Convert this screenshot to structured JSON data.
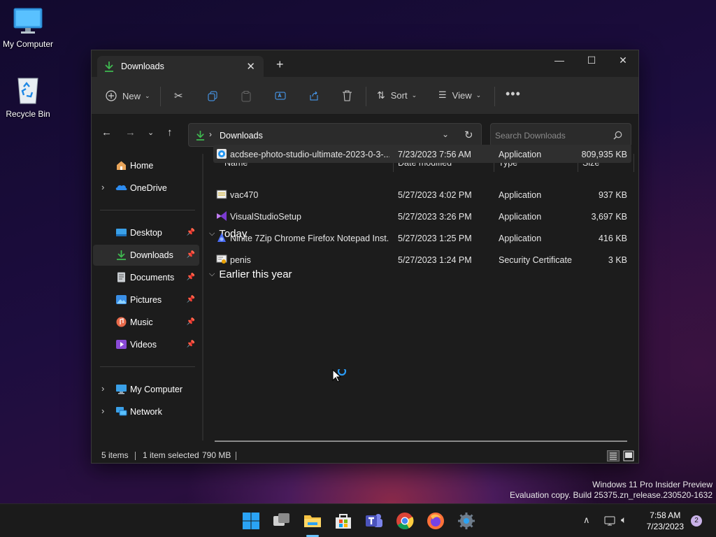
{
  "desktop": {
    "icons": [
      {
        "label": "My Computer"
      },
      {
        "label": "Recycle Bin"
      }
    ]
  },
  "window": {
    "tab_title": "Downloads",
    "toolbar": {
      "new_label": "New",
      "sort_label": "Sort",
      "view_label": "View"
    },
    "address": {
      "location": "Downloads"
    },
    "search": {
      "placeholder": "Search Downloads"
    },
    "sidebar": {
      "items": [
        {
          "label": "Home",
          "icon": "home-icon"
        },
        {
          "label": "OneDrive",
          "icon": "onedrive-icon"
        },
        {
          "label": "Desktop",
          "icon": "desktop-folder-icon"
        },
        {
          "label": "Downloads",
          "icon": "downloads-folder-icon"
        },
        {
          "label": "Documents",
          "icon": "documents-folder-icon"
        },
        {
          "label": "Pictures",
          "icon": "pictures-folder-icon"
        },
        {
          "label": "Music",
          "icon": "music-folder-icon"
        },
        {
          "label": "Videos",
          "icon": "videos-folder-icon"
        },
        {
          "label": "My Computer",
          "icon": "computer-icon"
        },
        {
          "label": "Network",
          "icon": "network-icon"
        }
      ]
    },
    "columns": {
      "name": "Name",
      "date": "Date modified",
      "type": "Type",
      "size": "Size"
    },
    "groups": [
      {
        "label": "Today",
        "files": [
          {
            "name": "acdsee-photo-studio-ultimate-2023-0-3-...",
            "date": "7/23/2023 7:56 AM",
            "type": "Application",
            "size": "809,935 KB"
          }
        ]
      },
      {
        "label": "Earlier this year",
        "files": [
          {
            "name": "vac470",
            "date": "5/27/2023 4:02 PM",
            "type": "Application",
            "size": "937 KB"
          },
          {
            "name": "VisualStudioSetup",
            "date": "5/27/2023 3:26 PM",
            "type": "Application",
            "size": "3,697 KB"
          },
          {
            "name": "Ninite 7Zip Chrome Firefox Notepad Inst...",
            "date": "5/27/2023 1:25 PM",
            "type": "Application",
            "size": "416 KB"
          },
          {
            "name": "penis",
            "date": "5/27/2023 1:24 PM",
            "type": "Security Certificate",
            "size": "3 KB"
          }
        ]
      }
    ],
    "status": {
      "items": "5 items",
      "selected": "1 item selected",
      "selected_size": "790 MB"
    }
  },
  "watermark": {
    "line1": "Windows 11 Pro Insider Preview",
    "line2": "Evaluation copy. Build 25375.zn_release.230520-1632"
  },
  "taskbar": {
    "time": "7:58 AM",
    "date": "7/23/2023",
    "notification_count": "2"
  },
  "colors": {
    "accent": "#0078d4",
    "download_green": "#3fb950",
    "window_bg": "#1c1c1c",
    "toolbar_bg": "#2b2b2b"
  }
}
